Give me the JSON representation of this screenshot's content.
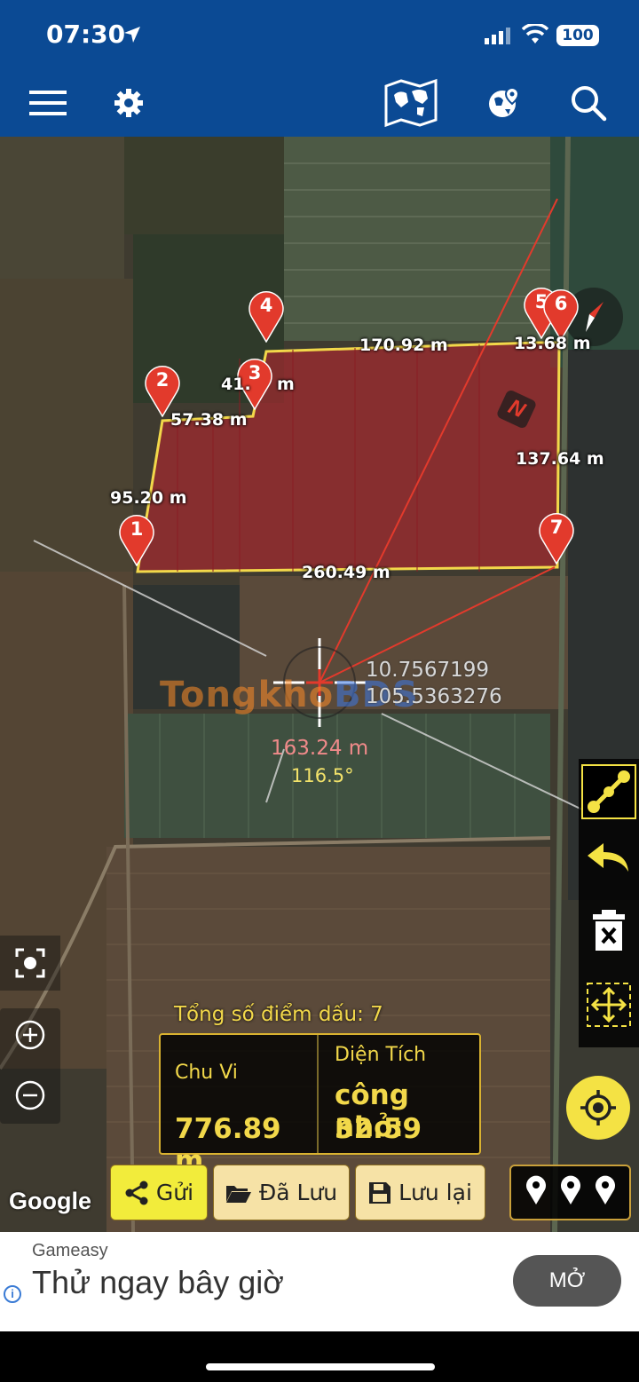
{
  "status_bar": {
    "time": "07:30",
    "battery": "100"
  },
  "header": {
    "icons": [
      "menu-icon",
      "settings-icon",
      "world-map-icon",
      "globe-pin-icon",
      "search-icon"
    ]
  },
  "map": {
    "markers": [
      {
        "id": "1"
      },
      {
        "id": "2"
      },
      {
        "id": "3"
      },
      {
        "id": "4"
      },
      {
        "id": "5"
      },
      {
        "id": "6"
      },
      {
        "id": "7"
      }
    ],
    "distances": {
      "seg_4_5": "170.92 m",
      "seg_5_6": "13.68 m",
      "seg_3_4": "41.",
      "seg_3_4_tail": "m",
      "seg_2_3": "57.38 m",
      "seg_1_2": "95.20 m",
      "seg_6_7": "137.64 m",
      "seg_7_1": "260.49 m"
    },
    "north_label": "N",
    "crosshair": {
      "latitude": "10.7567199",
      "longitude": "105.5363276",
      "distance": "163.24 m",
      "bearing": "116.5°"
    },
    "watermark": {
      "part1": "Tongkho",
      "part2": "BDS"
    },
    "google_label": "Google"
  },
  "stats": {
    "total_points": "Tổng số điểm dấu: 7",
    "perimeter_label": "Chu Vi",
    "perimeter_value": "776.89 m",
    "area_label": "Diện Tích",
    "area_unit": "công nhỏ:",
    "area_value": "32.59"
  },
  "buttons": {
    "send": "Gửi",
    "saved": "Đã Lưu",
    "save": "Lưu lại"
  },
  "ad": {
    "brand": "Gameasy",
    "title": "Thử ngay bây giờ",
    "cta": "MỞ"
  },
  "colors": {
    "header_bg": "#0b4a94",
    "polygon_fill": "#b3262e",
    "polygon_edge": "#f2d84a",
    "marker": "#e23a2c",
    "accent_yellow": "#f4e244"
  }
}
